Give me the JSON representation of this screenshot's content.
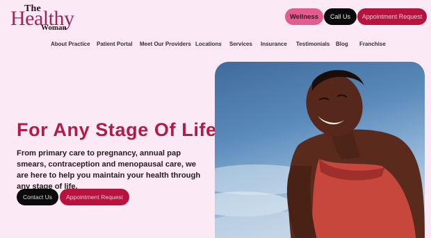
{
  "logo": {
    "line1": "The",
    "line2": "Healthy",
    "line3": "Woman"
  },
  "header_buttons": {
    "wellness": "Wellness",
    "call": "Call Us",
    "appointment": "Appointment Request"
  },
  "nav": [
    "About Practice",
    "Patient Portal",
    "Meet Our Providers",
    "Locations",
    "Services",
    "Insurance",
    "Testimonials",
    "Blog",
    "Franchise"
  ],
  "hero": {
    "headline": "For Any Stage Of Life",
    "subtext": "From primary care to pregnancy, annual pap smears, contraception and menopausal care, we are here to help you maintain your health through any stage of life.",
    "contact_button": "Contact Us",
    "appointment_button": "Appointment Request"
  },
  "colors": {
    "background": "#fbeaf6",
    "brand_primary": "#b8123e",
    "brand_accent": "#e25d8d",
    "dark": "#0b0b0b"
  }
}
